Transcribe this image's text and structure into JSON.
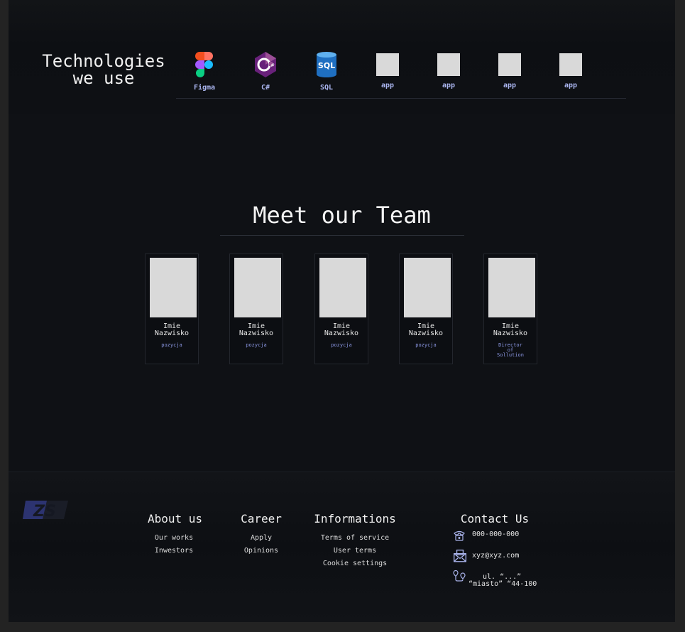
{
  "technologies": {
    "title_line1": "Technologies",
    "title_line2": "we use",
    "items": [
      {
        "label": "Figma",
        "icon": "figma-icon"
      },
      {
        "label": "C#",
        "icon": "csharp-icon"
      },
      {
        "label": "SQL",
        "icon": "sql-database-icon"
      },
      {
        "label": "app",
        "icon": "app-placeholder-icon"
      },
      {
        "label": "app",
        "icon": "app-placeholder-icon"
      },
      {
        "label": "app",
        "icon": "app-placeholder-icon"
      },
      {
        "label": "app",
        "icon": "app-placeholder-icon"
      }
    ]
  },
  "team": {
    "title": "Meet our Team",
    "members": [
      {
        "first": "Imie",
        "last": "Nazwisko",
        "role": "pozycja"
      },
      {
        "first": "Imie",
        "last": "Nazwisko",
        "role": "pozycja"
      },
      {
        "first": "Imie",
        "last": "Nazwisko",
        "role": "pozycja"
      },
      {
        "first": "Imie",
        "last": "Nazwisko",
        "role": "pozycja"
      },
      {
        "first": "Imie",
        "last": "Nazwisko",
        "role_line1": "Director",
        "role_line2": "of",
        "role_line3": "Sollution"
      }
    ]
  },
  "footer": {
    "logo_text": "ZS",
    "about": {
      "title": "About us",
      "links": [
        "Our works",
        "Inwestors"
      ]
    },
    "career": {
      "title": "Career",
      "links": [
        "Apply",
        "Opinions"
      ]
    },
    "informations": {
      "title": "Informations",
      "links": [
        "Terms of service",
        "User terms",
        "Cookie settings"
      ]
    },
    "contact": {
      "title": "Contact Us",
      "phone": "000-000-000",
      "email": "xyz@xyz.com",
      "address_line1": "ul. “...”",
      "address_line2": "“miasto” “44-100"
    }
  },
  "colors": {
    "background": "#0f1115",
    "accent_label": "#a9b4ee",
    "role_text": "#8d99e6",
    "placeholder": "#d9d9d9"
  }
}
